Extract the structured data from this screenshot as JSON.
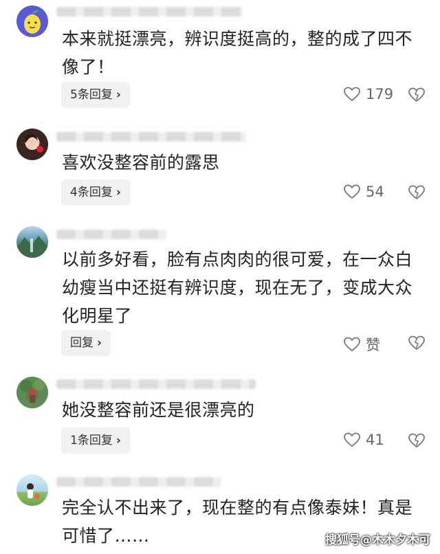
{
  "comments": [
    {
      "text": "本来就挺漂亮，辨识度挺高的，整的成了四不\n像了！",
      "reply_label": "5条回复",
      "likes": "179"
    },
    {
      "text": "喜欢没整容前的露思",
      "reply_label": "4条回复",
      "likes": "54"
    },
    {
      "text": "以前多好看，脸有点肉肉的很可爱，在一众白\n幼瘦当中还挺有辨识度，现在无了，变成大众\n化明星了",
      "reply_label": "回复",
      "likes": "赞"
    },
    {
      "text": "她没整容前还是很漂亮的",
      "reply_label": "1条回复",
      "likes": "41"
    },
    {
      "text": "完全认不出来了，现在整的有点像泰妹！真是\n可惜了……",
      "reply_label": "",
      "likes": ""
    }
  ],
  "watermark": "搜狐号@木木夕木可",
  "icons": {
    "like": "heart-outline-icon",
    "dislike": "broken-heart-icon",
    "reply_chevron": "chevron-right-icon"
  },
  "colors": {
    "text": "#222222",
    "meta": "#666666",
    "reply_bg": "#f1f1f1"
  }
}
